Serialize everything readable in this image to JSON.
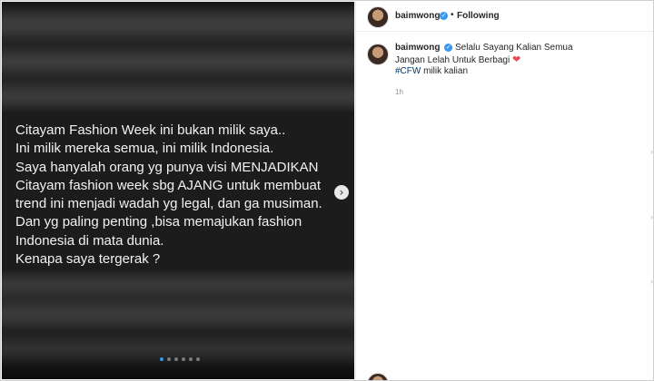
{
  "post": {
    "author": "baimwong",
    "follow_label": "Following",
    "separator": "•",
    "media": {
      "lines": [
        "Citayam Fashion Week ini bukan milik saya..",
        "Ini milik mereka semua, ini milik Indonesia.",
        "Saya hanyalah orang yg punya visi MENJADIKAN",
        "Citayam fashion week sbg AJANG untuk membuat",
        "trend ini menjadi wadah yg legal, dan ga musiman.",
        "Dan yg paling penting ,bisa memajukan fashion",
        "Indonesia di mata dunia.",
        "Kenapa saya tergerak ?"
      ],
      "next_icon": "›",
      "slide_count": 6,
      "active_slide": 1
    },
    "caption": {
      "username": "baimwong",
      "line1": "Selalu Sayang Kalian Semua",
      "line2": "Jangan Lelah Untuk Berbagi",
      "heart": "❤",
      "hashtag": "#CFW",
      "line3_rest": " milik kalian",
      "time": "1h"
    },
    "side_arrow": "›"
  },
  "colors": {
    "accent": "#3897f0",
    "hashtag": "#00376b",
    "heart": "#ed4956"
  }
}
